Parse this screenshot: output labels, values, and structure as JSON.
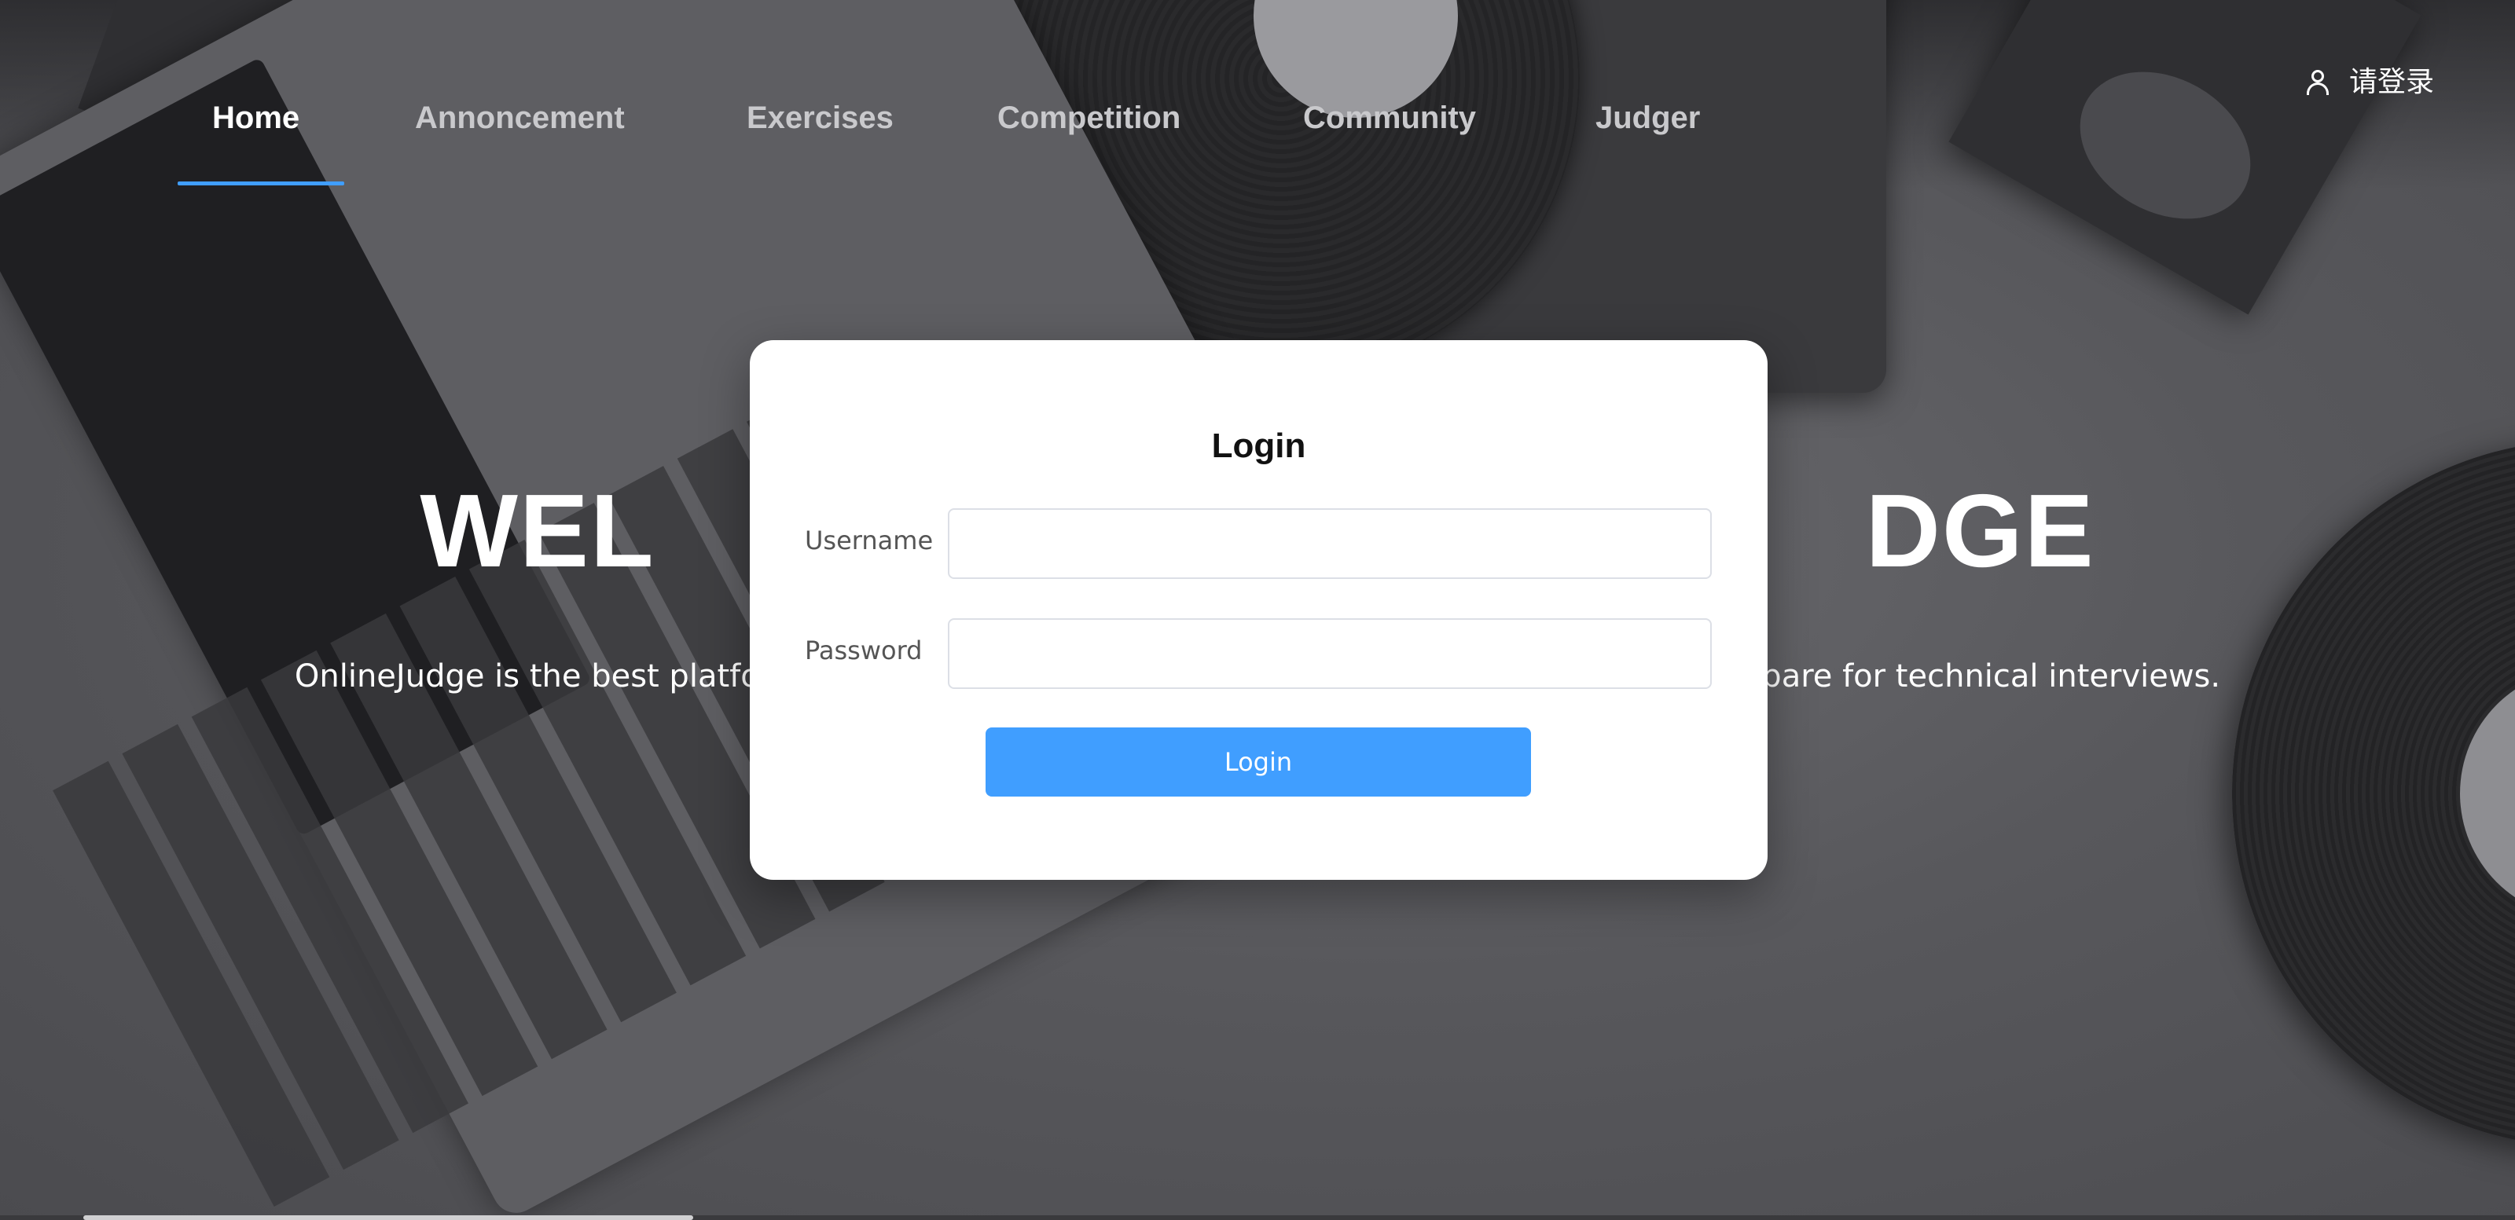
{
  "nav": {
    "items": [
      {
        "label": "Home",
        "active": true
      },
      {
        "label": "Annoncement",
        "active": false
      },
      {
        "label": "Exercises",
        "active": false
      },
      {
        "label": "Competition",
        "active": false
      },
      {
        "label": "Community",
        "active": false
      },
      {
        "label": "Judger",
        "active": false
      }
    ],
    "login_label": "请登录",
    "login_icon": "user-icon",
    "active_color": "#409eff"
  },
  "hero": {
    "title_left": "WEL",
    "title_right": "DGE",
    "subtitle_left": "OnlineJudge is the best platfo",
    "subtitle_right": "epare for technical interviews."
  },
  "login_modal": {
    "title": "Login",
    "username_label": "Username",
    "username_value": "",
    "password_label": "Password",
    "password_value": "",
    "submit_label": "Login",
    "accent_color": "#409eff"
  }
}
